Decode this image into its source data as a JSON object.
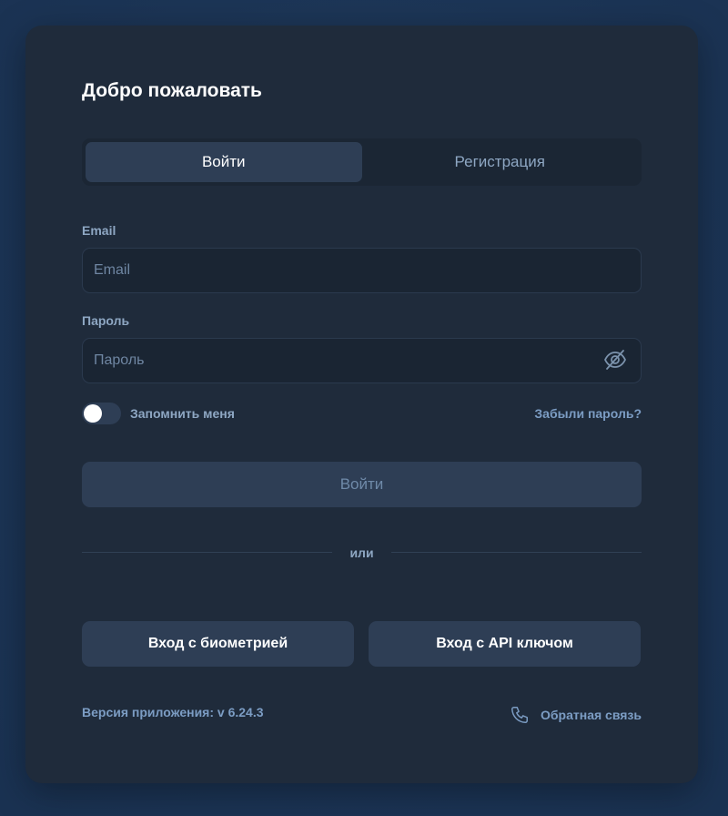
{
  "card": {
    "title": "Добро пожаловать"
  },
  "tabs": [
    {
      "label": "Войти",
      "active": true
    },
    {
      "label": "Регистрация",
      "active": false
    }
  ],
  "form": {
    "email_label": "Email",
    "email_placeholder": "Email",
    "email_value": "",
    "password_label": "Пароль",
    "password_placeholder": "Пароль",
    "password_value": "",
    "remember_label": "Запомнить меня",
    "remember_checked": false,
    "forgot_label": "Забыли пароль?",
    "submit_label": "Войти"
  },
  "divider_text": "или",
  "alt_buttons": {
    "biometric": "Вход с биометрией",
    "api_key": "Вход с API ключом"
  },
  "footer": {
    "version": "Версия приложения: v 6.24.3",
    "feedback": "Обратная связь"
  },
  "icons": {
    "password_toggle": "eye-off-icon",
    "feedback": "phone-icon"
  },
  "colors": {
    "background": "#1c3556",
    "card": "#1f2b3b",
    "button": "#2e3e55",
    "accent_text": "#7c9dc4"
  }
}
